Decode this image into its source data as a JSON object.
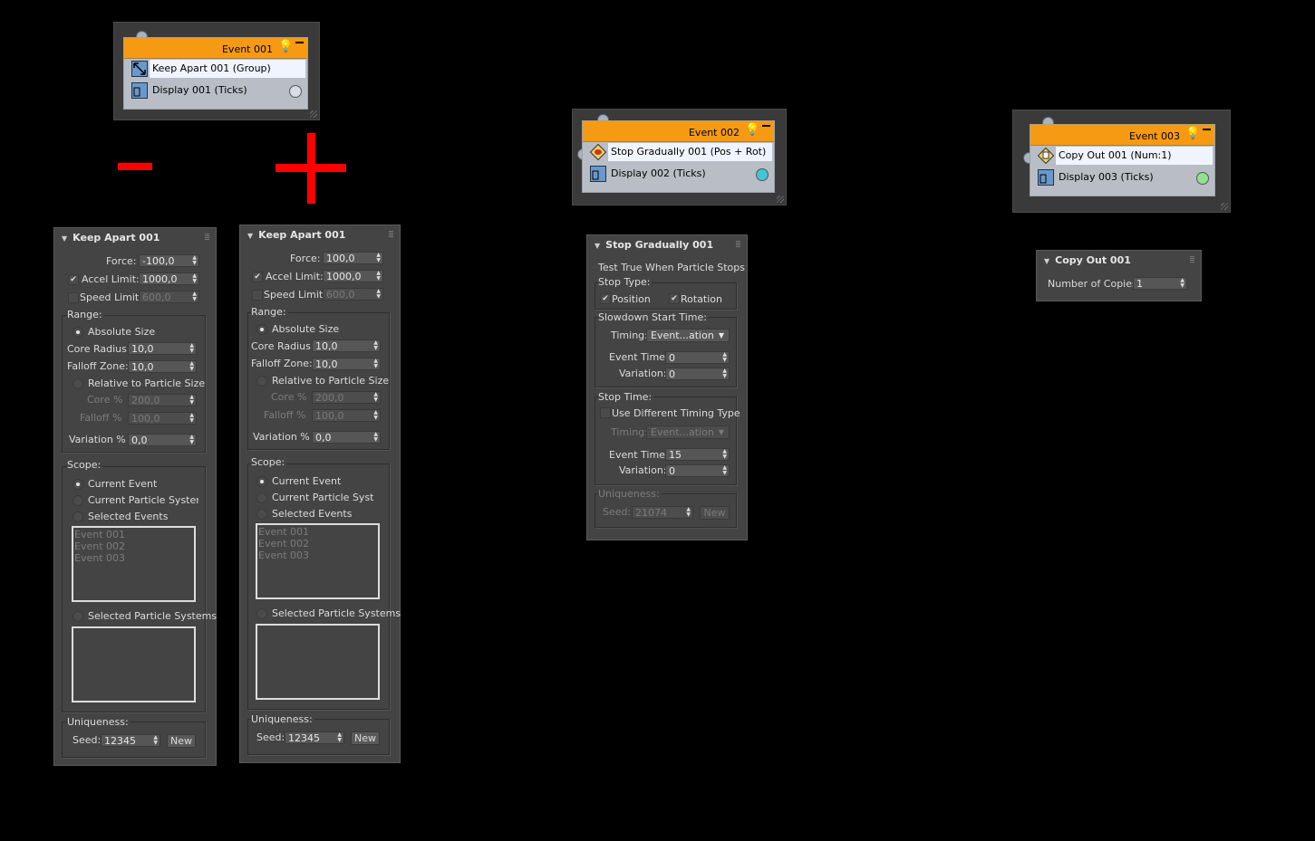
{
  "events": [
    {
      "title": "Event 001",
      "operators": [
        {
          "label": "Keep Apart 001 (Group)",
          "icon": "keep-apart-icon"
        },
        {
          "label": "Display 001 (Ticks)",
          "icon": "display-icon"
        }
      ],
      "display_color": "#d8dde4"
    },
    {
      "title": "Event 002",
      "operators": [
        {
          "label": "Stop Gradually 001 (Pos + Rot)",
          "icon": "stop-gradually-icon"
        },
        {
          "label": "Display 002 (Ticks)",
          "icon": "display-icon"
        }
      ],
      "display_color": "#3fc6d8"
    },
    {
      "title": "Event 003",
      "operators": [
        {
          "label": "Copy Out 001 (Num:1)",
          "icon": "copy-out-icon"
        },
        {
          "label": "Display 003 (Ticks)",
          "icon": "display-icon"
        }
      ],
      "display_color": "#8fe28f"
    }
  ],
  "markers": {
    "minus": "−",
    "plus": "+",
    "color": "#ff0000"
  },
  "keep_apart": [
    {
      "title": "Keep Apart 001",
      "force_label": "Force:",
      "force": "-100,0",
      "accel_label": "Accel Limit:",
      "accel": "1000,0",
      "accel_checked": "✔",
      "speed_label": "Speed Limit:",
      "speed": "600,0",
      "range_label": "Range:",
      "absolute_size": "Absolute Size",
      "core_radius_label": "Core Radius:",
      "core_radius": "10,0",
      "falloff_zone_label": "Falloff Zone:",
      "falloff_zone": "10,0",
      "relative_size": "Relative to Particle Size",
      "core_pct_label": "Core %",
      "core_pct": "200,0",
      "falloff_pct_label": "Falloff %",
      "falloff_pct": "100,0",
      "variation_label": "Variation %",
      "variation": "0,0",
      "scope_label": "Scope:",
      "current_event": "Current Event",
      "current_system": "Current Particle System",
      "selected_events": "Selected Events",
      "event_list": [
        "Event 001",
        "Event 002",
        "Event 003"
      ],
      "selected_systems": "Selected Particle Systems",
      "uniqueness_label": "Uniqueness:",
      "seed_label": "Seed:",
      "seed": "12345",
      "new_label": "New"
    },
    {
      "title": "Keep Apart 001",
      "force_label": "Force:",
      "force": "100,0",
      "accel_label": "Accel Limit:",
      "accel": "1000,0",
      "accel_checked": "✔",
      "speed_label": "Speed Limit:",
      "speed": "600,0",
      "range_label": "Range:",
      "absolute_size": "Absolute Size",
      "core_radius_label": "Core Radius:",
      "core_radius": "10,0",
      "falloff_zone_label": "Falloff Zone:",
      "falloff_zone": "10,0",
      "relative_size": "Relative to Particle Size",
      "core_pct_label": "Core %",
      "core_pct": "200,0",
      "falloff_pct_label": "Falloff %",
      "falloff_pct": "100,0",
      "variation_label": "Variation %",
      "variation": "0,0",
      "scope_label": "Scope:",
      "current_event": "Current Event",
      "current_system": "Current Particle System",
      "selected_events": "Selected Events",
      "event_list": [
        "Event 001",
        "Event 002",
        "Event 003"
      ],
      "selected_systems": "Selected Particle Systems",
      "uniqueness_label": "Uniqueness:",
      "seed_label": "Seed:",
      "seed": "12345",
      "new_label": "New"
    }
  ],
  "stop_gradually": {
    "title": "Stop Gradually 001",
    "test_label": "Test True When Particle Stops",
    "stop_type_label": "Stop Type:",
    "position_label": "Position",
    "rotation_label": "Rotation",
    "check": "✔",
    "slowdown_label": "Slowdown Start Time:",
    "timing_label": "Timing:",
    "timing_value": "Event...ation",
    "event_time_label": "Event Time:",
    "event_time": "0",
    "variation_label": "Variation:",
    "variation": "0",
    "stop_time_label": "Stop Time:",
    "diff_timing_label": "Use Different Timing Type",
    "timing2_label": "Timing:",
    "timing2_value": "Event...ation",
    "event_time2_label": "Event Time:",
    "event_time2": "15",
    "variation2_label": "Variation:",
    "variation2": "0",
    "uniqueness_label": "Uniqueness:",
    "seed_label": "Seed:",
    "seed": "21074",
    "new_label": "New"
  },
  "copy_out": {
    "title": "Copy Out 001",
    "copies_label": "Number of Copies:",
    "copies": "1"
  }
}
